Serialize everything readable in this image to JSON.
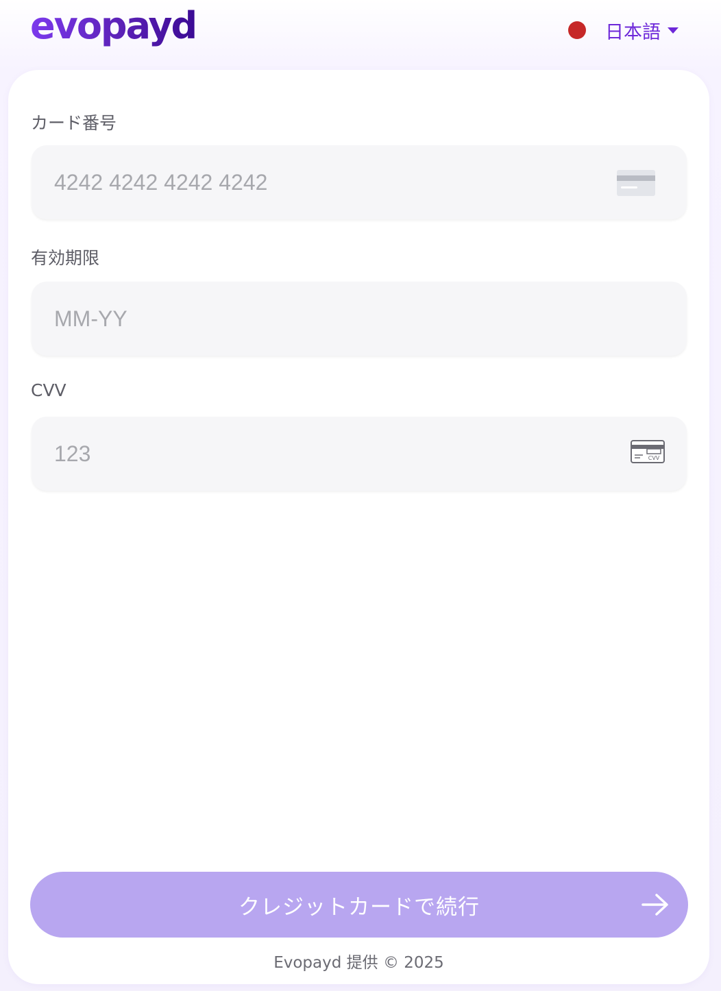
{
  "header": {
    "logo_text": "evopayd",
    "language": {
      "label": "日本語",
      "flag_color": "#c62828"
    }
  },
  "form": {
    "card_number": {
      "label": "カード番号",
      "placeholder": "4242 4242 4242 4242",
      "value": "",
      "icon": "credit-card-icon"
    },
    "expiry": {
      "label": "有効期限",
      "placeholder": "MM-YY",
      "value": ""
    },
    "cvv": {
      "label": "CVV",
      "placeholder": "123",
      "value": "",
      "icon": "cvv-card-icon",
      "icon_text": "CVV"
    }
  },
  "submit": {
    "label": "クレジットカードで続行",
    "icon": "arrow-right-icon"
  },
  "footer": {
    "text": "Evopayd 提供 © 2025"
  },
  "colors": {
    "brand": "#6d28d9",
    "button": "#b8a6f0",
    "input_bg": "#f6f6f8"
  }
}
